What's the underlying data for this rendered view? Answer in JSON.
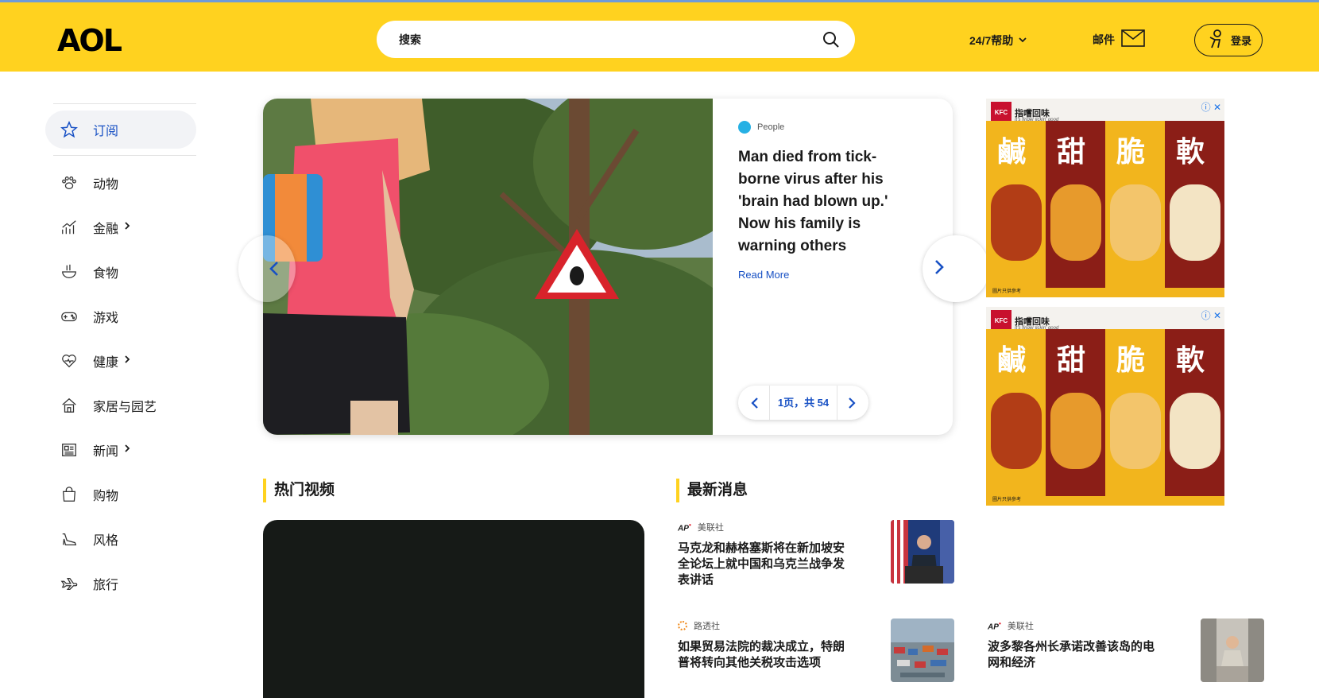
{
  "header": {
    "logo": "AOL",
    "search_placeholder": "搜索",
    "help_label": "24/7帮助",
    "mail_label": "邮件",
    "login_label": "登录"
  },
  "sidebar": {
    "items": [
      {
        "label": "订阅",
        "icon": "star-icon",
        "active": true
      },
      {
        "label": "动物",
        "icon": "paw-icon"
      },
      {
        "label": "金融",
        "icon": "chart-icon",
        "chevron": true
      },
      {
        "label": "食物",
        "icon": "bowl-icon"
      },
      {
        "label": "游戏",
        "icon": "gamepad-icon"
      },
      {
        "label": "健康",
        "icon": "heart-icon",
        "chevron": true
      },
      {
        "label": "家居与园艺",
        "icon": "house-icon"
      },
      {
        "label": "新闻",
        "icon": "newspaper-icon",
        "chevron": true
      },
      {
        "label": "购物",
        "icon": "bag-icon"
      },
      {
        "label": "风格",
        "icon": "shoe-icon"
      },
      {
        "label": "旅行",
        "icon": "plane-icon"
      }
    ]
  },
  "hero": {
    "source": "People",
    "title": "Man died from tick-borne virus after his 'brain had blown up.' Now his family is warning others",
    "read_more": "Read More",
    "pager_label": "1页，共 54"
  },
  "ads": {
    "brand": "指嚐回味",
    "tagline": "It's finger lickin' good",
    "kfc": "KFC",
    "chars": [
      "鹹",
      "甜",
      "脆",
      "軟"
    ],
    "footnote": "圖片只供參考"
  },
  "sections": {
    "videos_title": "热门视频",
    "news_title": "最新消息"
  },
  "news": [
    {
      "source": "美联社",
      "source_type": "ap",
      "title": "马克龙和赫格塞斯将在新加坡安全论坛上就中国和乌克兰战争发表讲话"
    },
    {
      "source": "路透社",
      "source_type": "reuters",
      "title": "如果贸易法院的裁决成立，特朗普将转向其他关税攻击选项"
    },
    {
      "source": "美联社",
      "source_type": "ap",
      "title": "波多黎各州长承诺改善该岛的电网和经济"
    }
  ],
  "colors": {
    "brand_yellow": "#ffd21f",
    "link_blue": "#1750c4",
    "video_bg": "#161a17"
  }
}
